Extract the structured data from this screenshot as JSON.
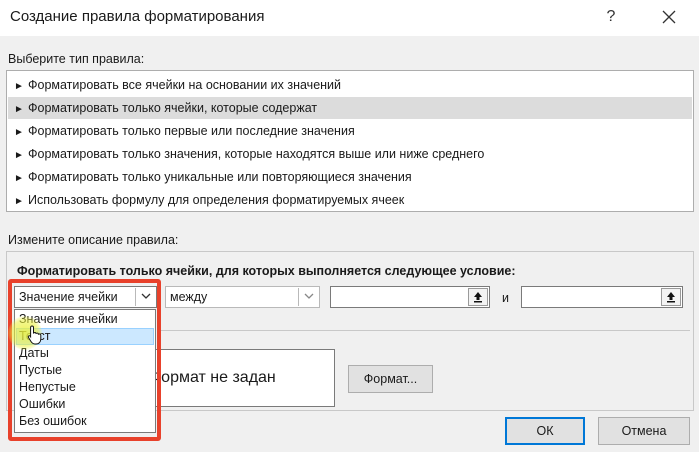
{
  "dialog": {
    "title": "Создание правила форматирования",
    "help_label": "?"
  },
  "rule_type": {
    "label": "Выберите тип правила:",
    "items": [
      {
        "label": "Форматировать все ячейки на основании их значений",
        "selected": false
      },
      {
        "label": "Форматировать только ячейки, которые содержат",
        "selected": true
      },
      {
        "label": "Форматировать только первые или последние значения",
        "selected": false
      },
      {
        "label": "Форматировать только значения, которые находятся выше или ниже среднего",
        "selected": false
      },
      {
        "label": "Форматировать только уникальные или повторяющиеся значения",
        "selected": false
      },
      {
        "label": "Использовать формулу для определения форматируемых ячеек",
        "selected": false
      }
    ],
    "bullet_icon": "arrow-right-icon"
  },
  "rule_description": {
    "label": "Измените описание правила:",
    "heading": "Форматировать только ячейки, для которых выполняется следующее условие:",
    "condition_type": {
      "value": "Значение ячейки"
    },
    "operator": {
      "value": "между"
    },
    "value1": {
      "value": ""
    },
    "and_label": "и",
    "value2": {
      "value": ""
    },
    "dropdown_options": [
      {
        "label": "Значение ячейки",
        "highlighted": false
      },
      {
        "label": "Текст",
        "highlighted": true
      },
      {
        "label": "Даты",
        "highlighted": false
      },
      {
        "label": "Пустые",
        "highlighted": false
      },
      {
        "label": "Непустые",
        "highlighted": false
      },
      {
        "label": "Ошибки",
        "highlighted": false
      },
      {
        "label": "Без ошибок",
        "highlighted": false
      }
    ]
  },
  "preview": {
    "text": "Формат не задан",
    "format_button": "Формат..."
  },
  "buttons": {
    "ok": "ОК",
    "cancel": "Отмена"
  },
  "colors": {
    "highlight_frame": "#e8412b",
    "selected_row": "#dcdcdc",
    "option_highlight": "#cce8ff",
    "default_button_border": "#0078d7"
  }
}
